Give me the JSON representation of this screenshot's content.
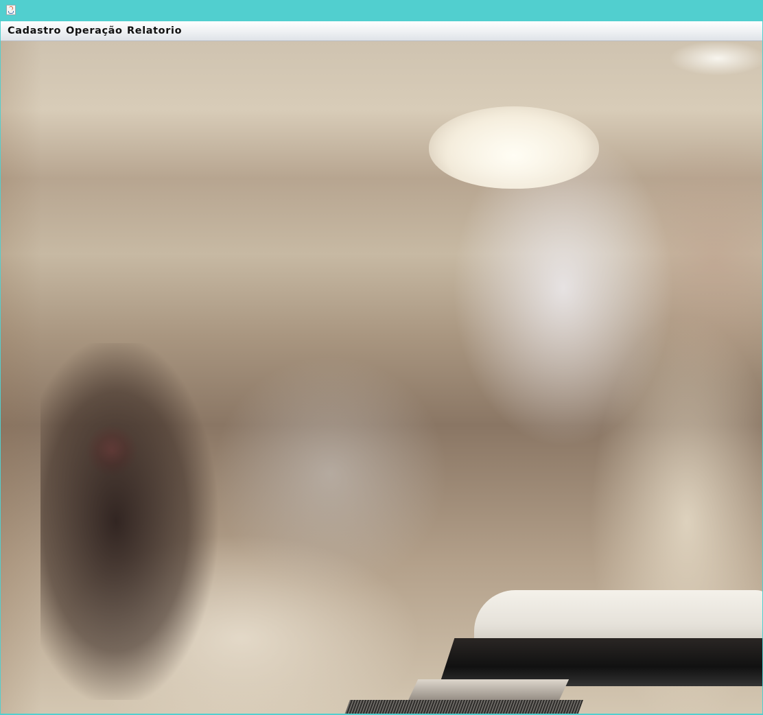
{
  "window": {
    "title": "",
    "icon": "java-cup-icon",
    "accent_color": "#51cfcf"
  },
  "menubar": {
    "items": [
      {
        "label": "Cadastro"
      },
      {
        "label": "Operação"
      },
      {
        "label": "Relatorio"
      }
    ]
  },
  "content": {
    "background_image": "barbershop-photo"
  }
}
